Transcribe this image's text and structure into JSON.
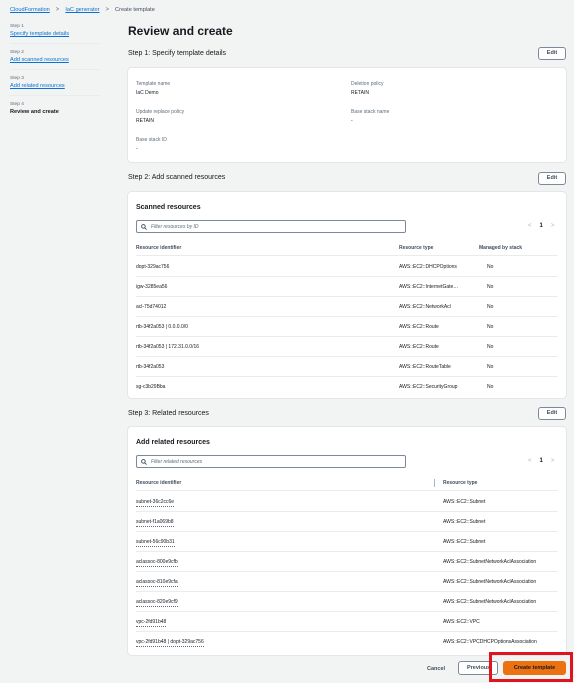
{
  "breadcrumb": {
    "items": [
      "CloudFormation",
      "IaC generator"
    ],
    "current": "Create template"
  },
  "steps": [
    {
      "num": "Step 1",
      "label": "Specify template details",
      "active": false
    },
    {
      "num": "Step 2",
      "label": "Add scanned resources",
      "active": false
    },
    {
      "num": "Step 3",
      "label": "Add related resources",
      "active": false
    },
    {
      "num": "Step 4",
      "label": "Review and create",
      "active": true
    }
  ],
  "page_title": "Review and create",
  "step1": {
    "heading": "Step 1: Specify template details",
    "edit": "Edit",
    "fields": {
      "template_name_label": "Template name",
      "template_name_value": "IaC Demo",
      "deletion_policy_label": "Deletion policy",
      "deletion_policy_value": "RETAIN",
      "update_replace_label": "Update replace policy",
      "update_replace_value": "RETAIN",
      "base_stack_name_label": "Base stack name",
      "base_stack_name_value": "-",
      "base_stack_id_label": "Base stack ID",
      "base_stack_id_value": "-"
    }
  },
  "step2": {
    "heading": "Step 2: Add scanned resources",
    "edit": "Edit",
    "panel_title": "Scanned resources",
    "filter_placeholder": "Filter resources by ID",
    "page": "1",
    "columns": [
      "Resource identifier",
      "Resource type",
      "Managed by stack"
    ],
    "rows": [
      [
        "dopt-329ac756",
        "AWS::EC2::DHCPOptions",
        "No"
      ],
      [
        "igw-3285ea56",
        "AWS::EC2::InternetGate…",
        "No"
      ],
      [
        "acl-75d74012",
        "AWS::EC2::NetworkAcl",
        "No"
      ],
      [
        "rtb-34f2a053 | 0.0.0.0/0",
        "AWS::EC2::Route",
        "No"
      ],
      [
        "rtb-34f2a053 | 172.31.0.0/16",
        "AWS::EC2::Route",
        "No"
      ],
      [
        "rtb-34f2a053",
        "AWS::EC2::RouteTable",
        "No"
      ],
      [
        "sg-c3b29Bba",
        "AWS::EC2::SecurityGroup",
        "No"
      ]
    ]
  },
  "step3": {
    "heading": "Step 3: Related resources",
    "edit": "Edit",
    "panel_title": "Add related resources",
    "filter_placeholder": "Filter related resources",
    "page": "1",
    "columns": [
      "Resource identifier",
      "Resource type"
    ],
    "rows": [
      [
        "subnet-36c2cc6e",
        "AWS::EC2::Subnet"
      ],
      [
        "subnet-f1a069b8",
        "AWS::EC2::Subnet"
      ],
      [
        "subnet-56c90b31",
        "AWS::EC2::Subnet"
      ],
      [
        "aclassoc-800e9cfb",
        "AWS::EC2::SubnetNetworkAclAssociation"
      ],
      [
        "aclassoc-810e9cfa",
        "AWS::EC2::SubnetNetworkAclAssociation"
      ],
      [
        "aclassoc-820e9cf9",
        "AWS::EC2::SubnetNetworkAclAssociation"
      ],
      [
        "vpc-2fd91b48",
        "AWS::EC2::VPC"
      ],
      [
        "vpc-2fd91b48 | dopt-329ac756",
        "AWS::EC2::VPCDHCPOptionsAssociation"
      ]
    ]
  },
  "footer": {
    "cancel": "Cancel",
    "previous": "Previous",
    "create": "Create template"
  },
  "colors": {
    "link": "#0972d3",
    "primary_button": "#ec7211",
    "highlight": "#e0141e"
  }
}
